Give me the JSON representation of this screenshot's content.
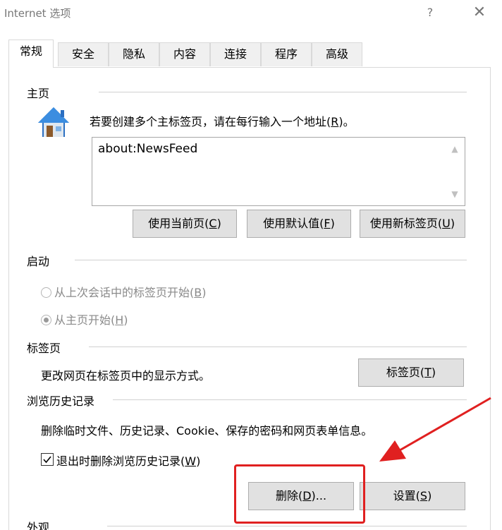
{
  "window": {
    "title": "Internet 选项",
    "help": "?",
    "close": "✕"
  },
  "tabs": [
    "常规",
    "安全",
    "隐私",
    "内容",
    "连接",
    "程序",
    "高级"
  ],
  "homepage": {
    "label": "主页",
    "hint_prefix": "若要创建多个主标签页，请在每行输入一个地址(",
    "hint_key": "R",
    "hint_suffix": ")。",
    "url": "about:NewsFeed",
    "buttons": {
      "current": {
        "prefix": "使用当前页(",
        "key": "C",
        "suffix": ")"
      },
      "default": {
        "prefix": "使用默认值(",
        "key": "F",
        "suffix": ")"
      },
      "newtab": {
        "prefix": "使用新标签页(",
        "key": "U",
        "suffix": ")"
      }
    }
  },
  "startup": {
    "label": "启动",
    "option1": {
      "prefix": "从上次会话中的标签页开始(",
      "key": "B",
      "suffix": ")"
    },
    "option2": {
      "prefix": "从主页开始(",
      "key": "H",
      "suffix": ")"
    },
    "selected": "option2"
  },
  "tabs_section": {
    "label": "标签页",
    "desc": "更改网页在标签页中的显示方式。",
    "button": {
      "prefix": "标签页(",
      "key": "T",
      "suffix": ")"
    }
  },
  "history": {
    "label": "浏览历史记录",
    "desc": "删除临时文件、历史记录、Cookie、保存的密码和网页表单信息。",
    "checkbox": {
      "prefix": "退出时删除浏览历史记录(",
      "key": "W",
      "suffix": ")",
      "checked": true
    },
    "delete": {
      "prefix": "删除(",
      "key": "D",
      "suffix": ")..."
    },
    "settings": {
      "prefix": "设置(",
      "key": "S",
      "suffix": ")"
    }
  },
  "appearance": {
    "label": "外观"
  },
  "colors": {
    "annotation": "#e02020",
    "button_bg": "#e1e1e1",
    "border": "#adadad"
  }
}
